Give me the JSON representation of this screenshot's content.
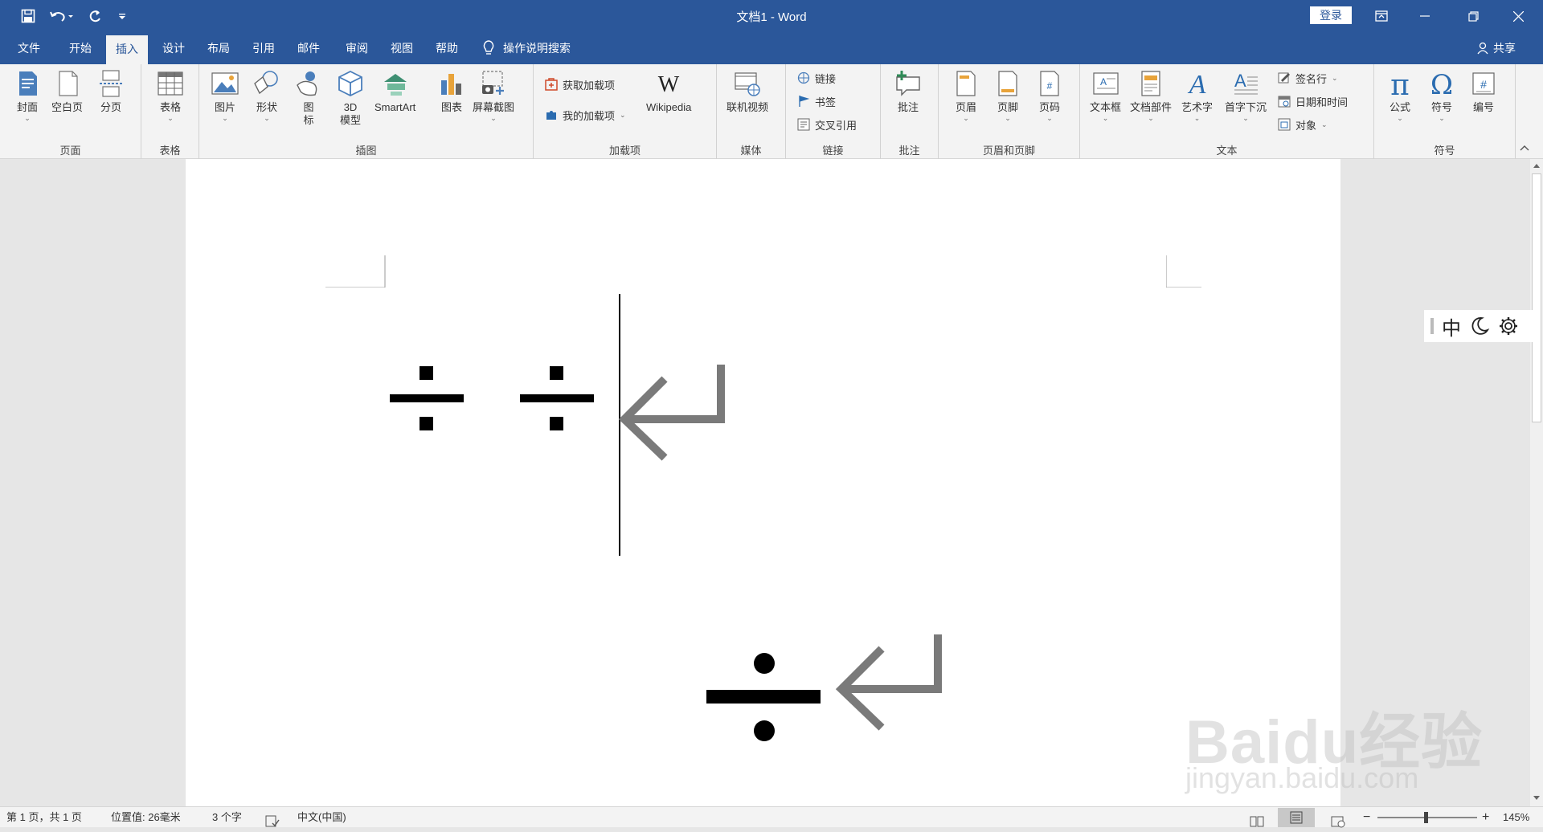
{
  "window": {
    "title": "文档1 - Word",
    "login": "登录"
  },
  "tabs": [
    {
      "label": "文件"
    },
    {
      "label": "开始"
    },
    {
      "label": "插入",
      "active": true
    },
    {
      "label": "设计"
    },
    {
      "label": "布局"
    },
    {
      "label": "引用"
    },
    {
      "label": "邮件"
    },
    {
      "label": "审阅"
    },
    {
      "label": "视图"
    },
    {
      "label": "帮助"
    }
  ],
  "search": {
    "label": "操作说明搜索"
  },
  "share": {
    "label": "共享"
  },
  "ribbon": {
    "pages": {
      "label": "页面",
      "cover": "封面",
      "blank": "空白页",
      "pagebreak": "分页"
    },
    "tables": {
      "label": "表格",
      "table": "表格"
    },
    "illustrations": {
      "label": "插图",
      "picture": "图片",
      "shapes": "形状",
      "icons_1": "图",
      "icons_2": "标",
      "model_1": "3D",
      "model_2": "模型",
      "smartart": "SmartArt",
      "chart": "图表",
      "screenshot": "屏幕截图"
    },
    "addins": {
      "label": "加载项",
      "get": "获取加载项",
      "my": "我的加载项",
      "wikipedia": "Wikipedia"
    },
    "media": {
      "label": "媒体",
      "video": "联机视频"
    },
    "links": {
      "label": "链接",
      "link": "链接",
      "bookmark": "书签",
      "crossref": "交叉引用"
    },
    "comments": {
      "label": "批注",
      "comment": "批注"
    },
    "headerfooter": {
      "label": "页眉和页脚",
      "header": "页眉",
      "footer": "页脚",
      "pagenum": "页码"
    },
    "text": {
      "label": "文本",
      "textbox": "文本框",
      "quickparts": "文档部件",
      "wordart": "艺术字",
      "dropcap": "首字下沉",
      "signature": "签名行",
      "datetime": "日期和时间",
      "object": "对象"
    },
    "symbols": {
      "label": "符号",
      "equation": "公式",
      "symbol": "符号",
      "number": "编号"
    }
  },
  "document": {
    "line1": "÷ ÷",
    "line2": "÷"
  },
  "ime": {
    "mode": "中"
  },
  "status": {
    "page": "第 1 页，共 1 页",
    "position": "位置值: 26毫米",
    "words": "3 个字",
    "language": "中文(中国)",
    "zoom": "145%"
  },
  "watermark": {
    "brand": "Baidu经验",
    "url": "jingyan.baidu.com"
  }
}
